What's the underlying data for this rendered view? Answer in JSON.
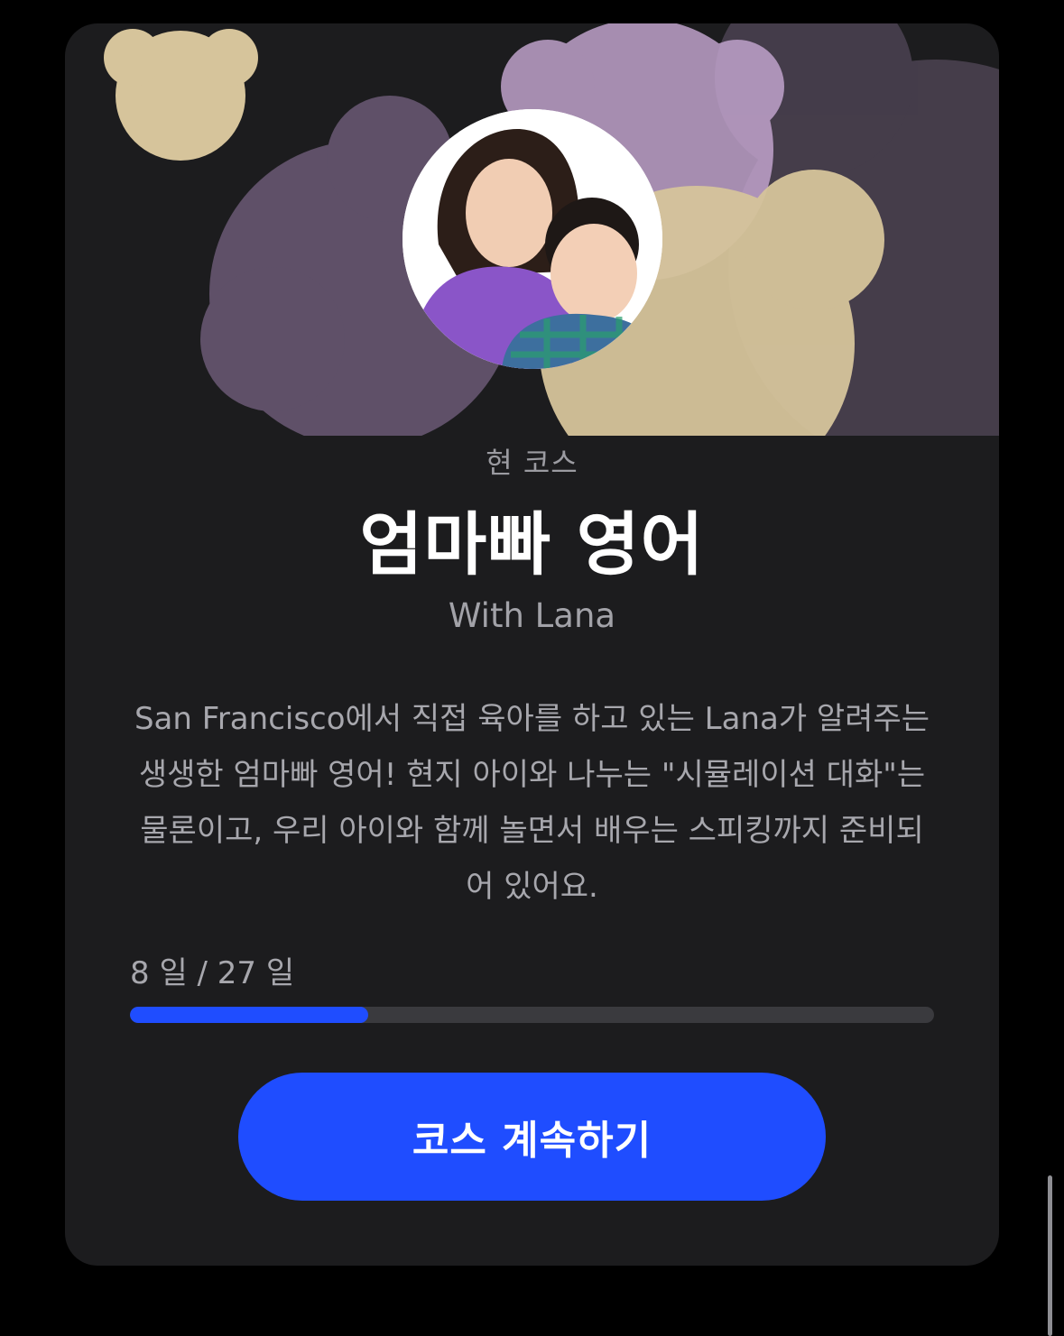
{
  "course": {
    "label": "현 코스",
    "title": "엄마빠 영어",
    "subtitle": "With Lana",
    "description": "San Francisco에서 직접 육아를 하고 있는 Lana가 알려주는 생생한 엄마빠 영어! 현지 아이와 나누는 \"시뮬레이션 대화\"는 물론이고, 우리 아이와 함께 놀면서 배우는 스피킹까지 준비되어 있어요."
  },
  "progress": {
    "text": "8 일 / 27 일",
    "current_day": 8,
    "total_days": 27,
    "fraction": 0.296
  },
  "cta": {
    "label": "코스 계속하기"
  },
  "colors": {
    "accent": "#1f4dff",
    "card_bg": "#1c1c1e",
    "bear_tan": "#d6c49b",
    "bear_purple": "#c5a6d1",
    "bear_dark_purple": "#6c5a77"
  }
}
